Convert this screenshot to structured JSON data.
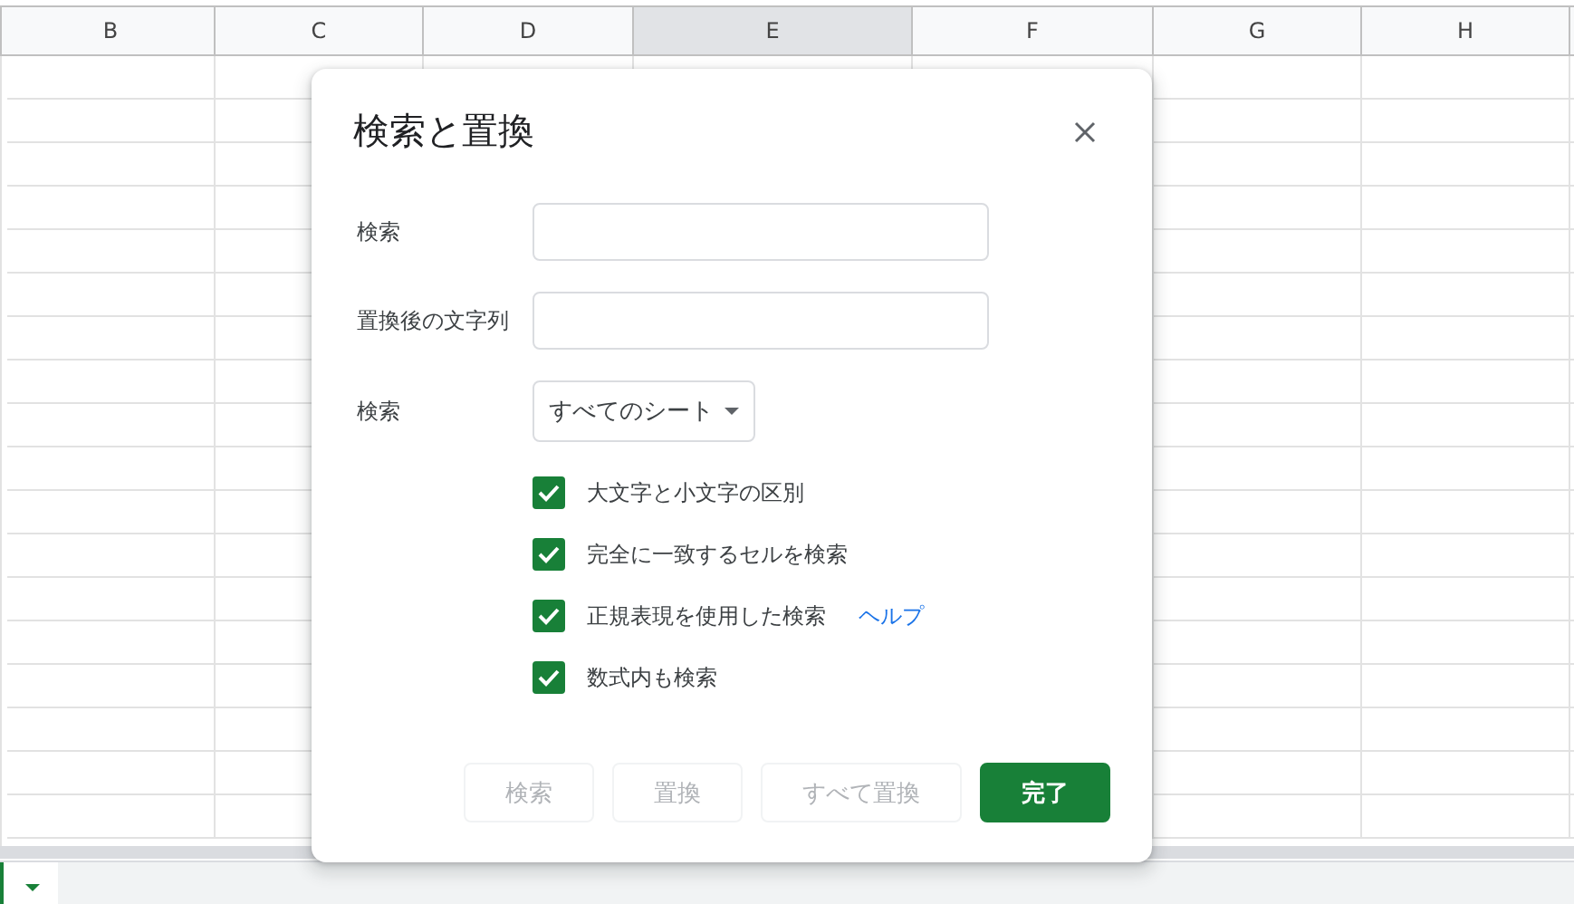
{
  "sheet": {
    "columns": [
      {
        "label": "B",
        "selected": false
      },
      {
        "label": "C",
        "selected": false
      },
      {
        "label": "D",
        "selected": false
      },
      {
        "label": "E",
        "selected": true
      },
      {
        "label": "F",
        "selected": false
      },
      {
        "label": "G",
        "selected": false
      },
      {
        "label": "H",
        "selected": false
      }
    ]
  },
  "dialog": {
    "title": "検索と置換",
    "fields": [
      {
        "label": "検索",
        "kind": "text"
      },
      {
        "label": "置換後の文字列",
        "kind": "text"
      },
      {
        "label": "検索",
        "kind": "select",
        "value": "すべてのシート"
      }
    ],
    "options": [
      {
        "label": "大文字と小文字の区別",
        "checked": true
      },
      {
        "label": "完全に一致するセルを検索",
        "checked": true
      },
      {
        "label": "正規表現を使用した検索",
        "checked": true,
        "link": "ヘルプ"
      },
      {
        "label": "数式内も検索",
        "checked": true
      }
    ],
    "buttons": [
      {
        "label": "検索",
        "kind": "secondary",
        "disabled": true
      },
      {
        "label": "置換",
        "kind": "secondary",
        "disabled": true
      },
      {
        "label": "すべて置換",
        "kind": "secondary",
        "disabled": true
      },
      {
        "label": "完了",
        "kind": "primary",
        "disabled": false
      }
    ]
  }
}
